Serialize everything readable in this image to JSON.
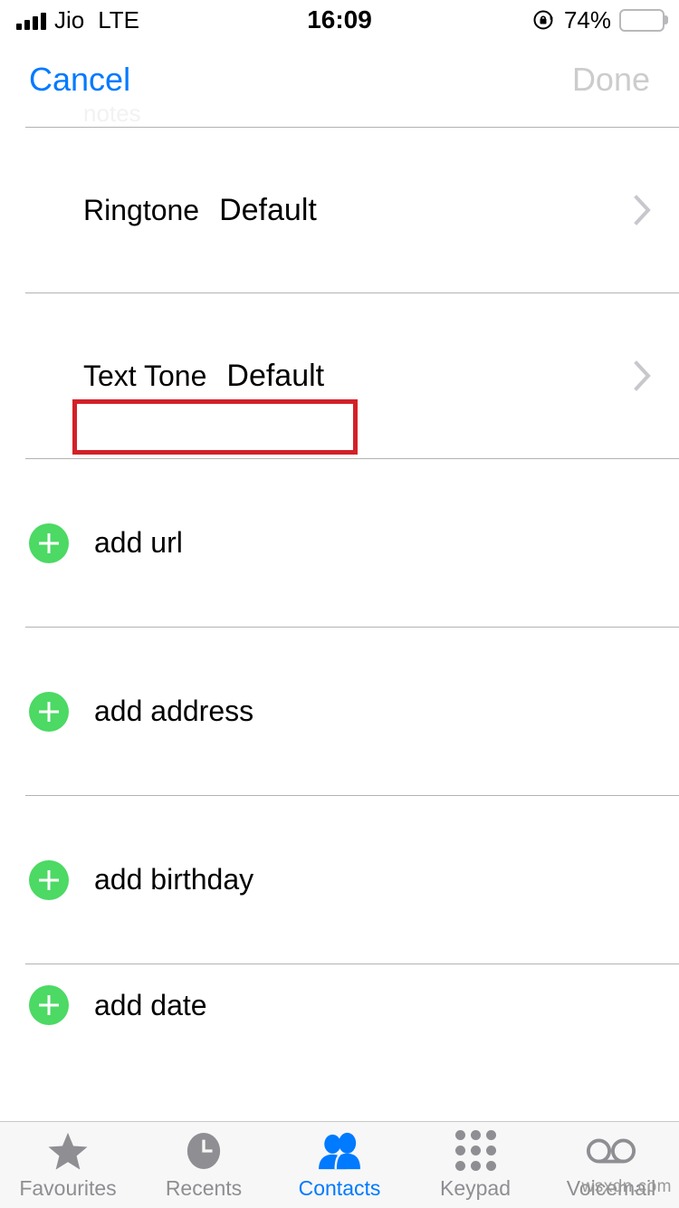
{
  "status_bar": {
    "carrier": "Jio",
    "network": "LTE",
    "time": "16:09",
    "battery_percent": "74%",
    "battery_level": 74,
    "signal_bars": 4,
    "rotation_lock_icon": "rotation-lock-icon"
  },
  "nav_bar": {
    "cancel_label": "Cancel",
    "done_label": "Done",
    "cancel_color": "#007AFF",
    "done_color": "#CCCCCC"
  },
  "content": {
    "ghost_row_text": "notes",
    "rows": [
      {
        "type": "tone",
        "label": "Ringtone",
        "value": "Default",
        "chevron": true,
        "highlighted": false
      },
      {
        "type": "tone",
        "label": "Text Tone",
        "value": "Default",
        "chevron": true,
        "highlighted": true
      },
      {
        "type": "add",
        "label": "add url"
      },
      {
        "type": "add",
        "label": "add address"
      },
      {
        "type": "add",
        "label": "add birthday"
      },
      {
        "type": "add",
        "label": "add date"
      }
    ],
    "add_button_color": "#4CD964",
    "chevron_color": "#C7C7CC",
    "separator_color": "#B2B2B2"
  },
  "annotation": {
    "color": "#D32028",
    "target": "Text Tone Default"
  },
  "tab_bar": {
    "active_index": 2,
    "active_color": "#007AFF",
    "inactive_color": "#8E8E93",
    "tabs": [
      {
        "label": "Favourites",
        "icon": "star-icon"
      },
      {
        "label": "Recents",
        "icon": "clock-icon"
      },
      {
        "label": "Contacts",
        "icon": "people-icon"
      },
      {
        "label": "Keypad",
        "icon": "keypad-dots-icon"
      },
      {
        "label": "Voicemail",
        "icon": "voicemail-icon"
      }
    ]
  },
  "watermark": {
    "text": "wsxdn.com"
  }
}
